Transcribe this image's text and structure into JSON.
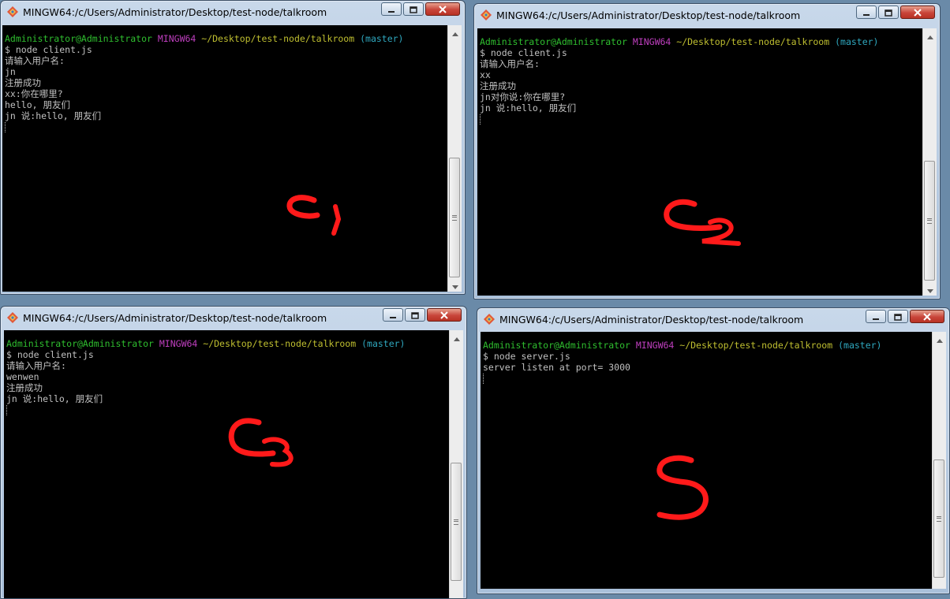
{
  "windows": [
    {
      "title": "MINGW64:/c/Users/Administrator/Desktop/test-node/talkroom",
      "prompt": {
        "user": "Administrator@Administrator",
        "env": "MINGW64",
        "path": "~/Desktop/test-node/talkroom",
        "branch": "(master)"
      },
      "lines": [
        "$ node client.js",
        "请输入用户名:",
        "jn",
        "注册成功",
        "xx:你在哪里?",
        "hello, 朋友们",
        "jn 说:hello, 朋友们"
      ],
      "annotation": "C1"
    },
    {
      "title": "MINGW64:/c/Users/Administrator/Desktop/test-node/talkroom",
      "prompt": {
        "user": "Administrator@Administrator",
        "env": "MINGW64",
        "path": "~/Desktop/test-node/talkroom",
        "branch": "(master)"
      },
      "lines": [
        "$ node client.js",
        "请输入用户名:",
        "xx",
        "注册成功",
        "jn对你说:你在哪里?",
        "jn 说:hello, 朋友们"
      ],
      "annotation": "C2"
    },
    {
      "title": "MINGW64:/c/Users/Administrator/Desktop/test-node/talkroom",
      "prompt": {
        "user": "Administrator@Administrator",
        "env": "MINGW64",
        "path": "~/Desktop/test-node/talkroom",
        "branch": "(master)"
      },
      "lines": [
        "$ node client.js",
        "请输入用户名:",
        "wenwen",
        "注册成功",
        "jn 说:hello, 朋友们"
      ],
      "annotation": "C3"
    },
    {
      "title": "MINGW64:/c/Users/Administrator/Desktop/test-node/talkroom",
      "prompt": {
        "user": "Administrator@Administrator",
        "env": "MINGW64",
        "path": "~/Desktop/test-node/talkroom",
        "branch": "(master)"
      },
      "lines": [
        "$ node server.js",
        "server listen at port= 3000"
      ],
      "annotation": "S"
    }
  ],
  "window_controls": {
    "minimize": "minimize-icon",
    "maximize": "maximize-icon",
    "close": "close-icon"
  },
  "colors": {
    "terminal_bg": "#000000",
    "user": "#2fbf2f",
    "env": "#bf3fbf",
    "path": "#bfbf30",
    "branch": "#2fa8bf",
    "text": "#c0c0c0",
    "annotation": "#ff1a1a"
  }
}
